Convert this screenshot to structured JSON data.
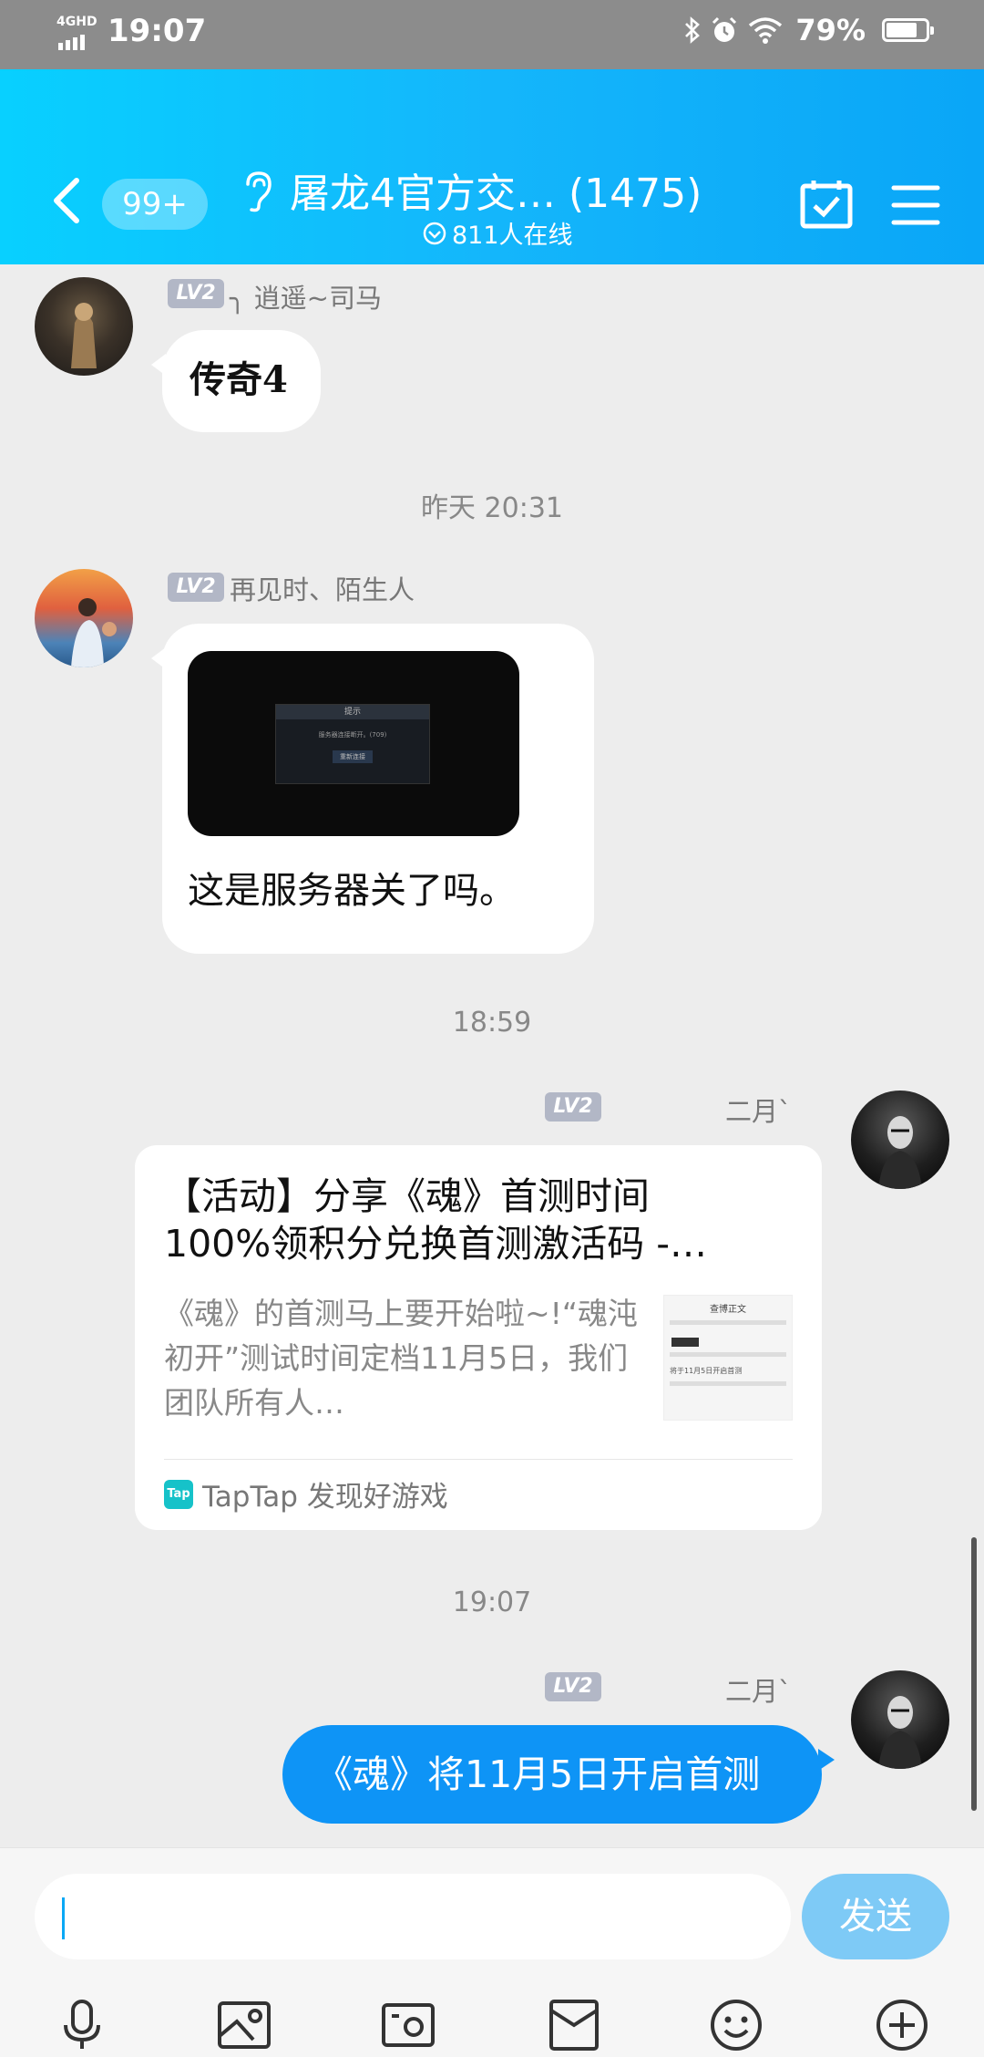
{
  "status_bar": {
    "network": "4GHD",
    "time": "19:07",
    "battery": "79%",
    "battery_level": 0.79
  },
  "header": {
    "unread": "99+",
    "title": "屠龙4官方交… (1475)",
    "online": "811人在线"
  },
  "messages": [
    {
      "level": "LV2",
      "nickname": "╮ 逍遥~司马",
      "text": "传奇4"
    },
    {
      "level": "LV2",
      "nickname": "再见时、陌生人",
      "text": "这是服务器关了吗。"
    },
    {
      "level": "LV2",
      "nickname": "二月ˋ",
      "card": {
        "title_line1": "【活动】分享《魂》首测时间",
        "title_line2": "100%领积分兑换首测激活码 -…",
        "desc": "《魂》的首测马上要开始啦~!“魂沌初开”测试时间定档11月5日，我们团队所有人…",
        "thumb_title": "查博正文",
        "thumb_text": "将于11月5日开启首测",
        "source": "TapTap 发现好游戏",
        "source_logo": "Tap"
      }
    },
    {
      "level": "LV2",
      "nickname": "二月ˋ",
      "text": "《魂》将11月5日开启首测"
    }
  ],
  "timestamps": [
    "昨天 20:31",
    "18:59",
    "19:07"
  ],
  "screenshot_dialog": {
    "title": "提示",
    "body": "服务器连接断开。(709)",
    "button": "重新连接"
  },
  "composer": {
    "send_label": "发送"
  },
  "toolbar": [
    "mic-icon",
    "image-icon",
    "camera-icon",
    "folder-icon",
    "emoji-icon",
    "plus-icon"
  ],
  "colors": {
    "header_start": "#08d0ff",
    "header_end": "#0aa6f7",
    "own_bubble": "#0e94f6",
    "send_button": "#7ecaf6",
    "level_badge": "#b2b7c6"
  }
}
